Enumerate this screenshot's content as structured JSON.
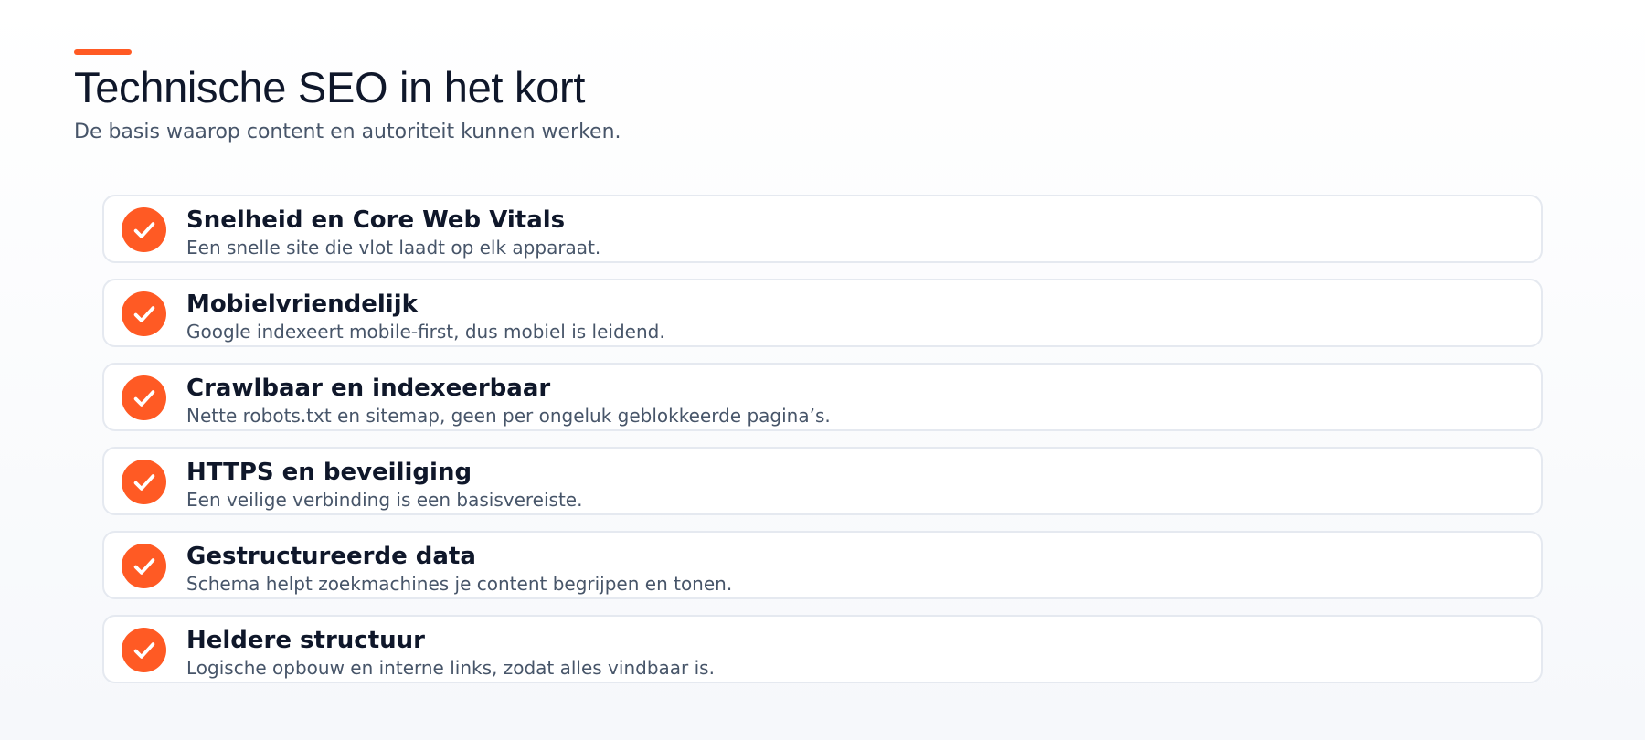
{
  "header": {
    "title": "Technische SEO in het kort",
    "subtitle": "De basis waarop content en autoriteit kunnen werken."
  },
  "theme": {
    "accent": "#ff5a24",
    "text": "#0f172a",
    "muted": "#475569"
  },
  "items": [
    {
      "icon": "check-circle-icon",
      "title": "Snelheid en Core Web Vitals",
      "description": "Een snelle site die vlot laadt op elk apparaat."
    },
    {
      "icon": "check-circle-icon",
      "title": "Mobielvriendelijk",
      "description": "Google indexeert mobile-first, dus mobiel is leidend."
    },
    {
      "icon": "check-circle-icon",
      "title": "Crawlbaar en indexeerbaar",
      "description": "Nette robots.txt en sitemap, geen per ongeluk geblokkeerde pagina’s."
    },
    {
      "icon": "check-circle-icon",
      "title": "HTTPS en beveiliging",
      "description": "Een veilige verbinding is een basisvereiste."
    },
    {
      "icon": "check-circle-icon",
      "title": "Gestructureerde data",
      "description": "Schema helpt zoekmachines je content begrijpen en tonen."
    },
    {
      "icon": "check-circle-icon",
      "title": "Heldere structuur",
      "description": "Logische opbouw en interne links, zodat alles vindbaar is."
    }
  ]
}
